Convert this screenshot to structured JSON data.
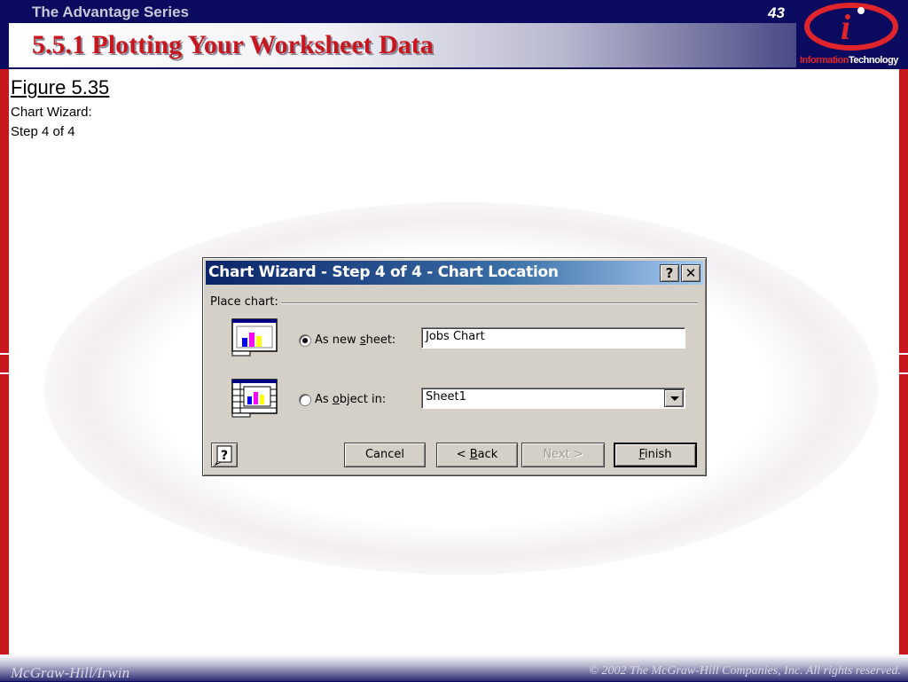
{
  "header": {
    "series_title": "The Advantage Series",
    "page_number": "43",
    "slide_title": "5.5.1 Plotting Your Worksheet Data",
    "logo_text_red": "Information",
    "logo_text_white": "Technology"
  },
  "content": {
    "figure_label": "Figure 5.35",
    "caption_line1": "Chart Wizard:",
    "caption_line2": "Step 4 of 4"
  },
  "dialog": {
    "title": "Chart Wizard - Step 4 of 4 - Chart Location",
    "help_glyph": "?",
    "close_glyph": "✕",
    "place_label": "Place chart:",
    "option_new_sheet": {
      "label_pre": "As new ",
      "label_accel": "s",
      "label_post": "heet:",
      "selected": true,
      "value": "Jobs Chart"
    },
    "option_object_in": {
      "label_pre": "As ",
      "label_accel": "o",
      "label_post": "bject in:",
      "selected": false,
      "value": "Sheet1"
    },
    "buttons": {
      "cancel": "Cancel",
      "back_pre": "< ",
      "back_accel": "B",
      "back_post": "ack",
      "next": "Next >",
      "finish_accel": "F",
      "finish_post": "inish"
    }
  },
  "footer": {
    "publisher": "McGraw-Hill/Irwin",
    "copyright": "© 2002  The McGraw-Hill Companies, Inc. All rights reserved."
  },
  "colors": {
    "navy": "#0a0a5e",
    "accent_red": "#c8161e",
    "dialog_gray": "#d4d0c8",
    "titlebar_blue": "#0a246a"
  }
}
